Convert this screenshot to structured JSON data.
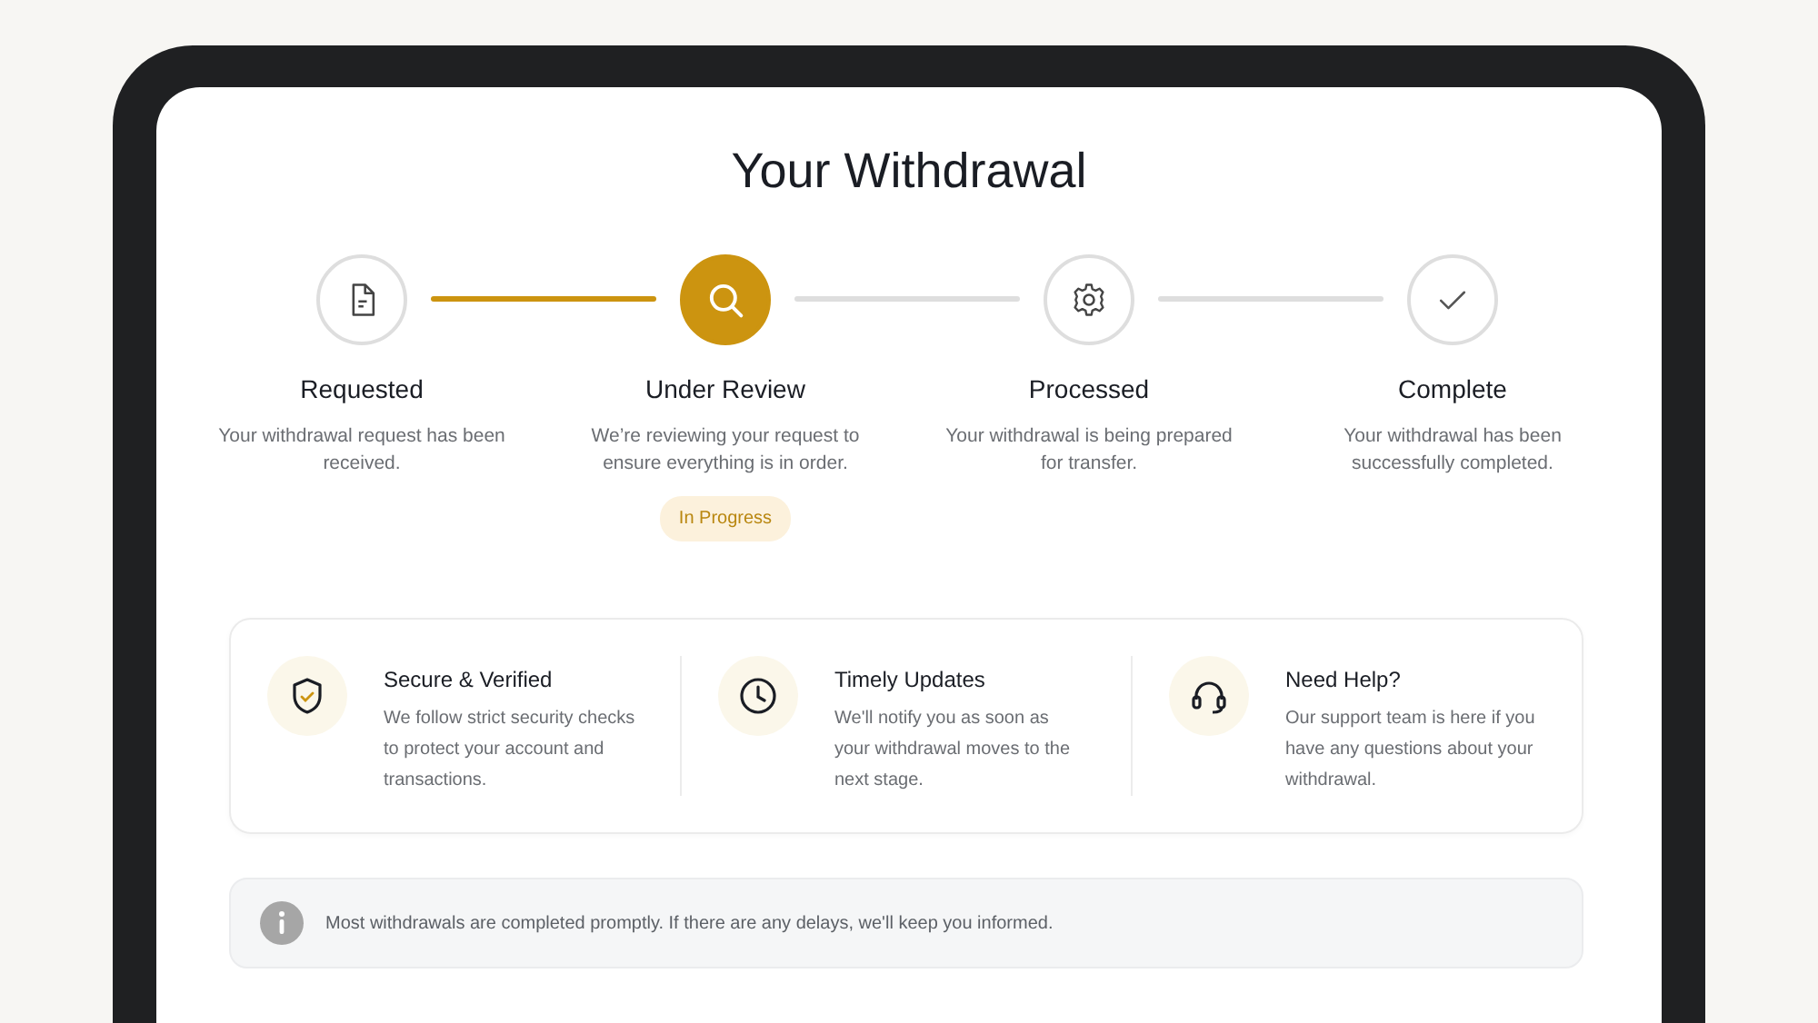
{
  "title": "Your Withdrawal",
  "steps": [
    {
      "label": "Requested",
      "description": "Your withdrawal request has been received.",
      "current": false
    },
    {
      "label": "Under Review",
      "description": "We’re reviewing your request to ensure everything is in order.",
      "current": true,
      "badge": "In Progress"
    },
    {
      "label": "Processed",
      "description": "Your withdrawal is being prepared for transfer.",
      "current": false
    },
    {
      "label": "Complete",
      "description": "Your withdrawal has been successfully completed.",
      "current": false
    }
  ],
  "connectors": [
    {
      "completed": true
    },
    {
      "completed": false
    },
    {
      "completed": false
    }
  ],
  "features": [
    {
      "title": "Secure & Verified",
      "text": "We follow strict security checks to protect your account and transactions."
    },
    {
      "title": "Timely Updates",
      "text": "We'll notify you as soon as your withdrawal moves to the next stage."
    },
    {
      "title": "Need Help?",
      "text": "Our support team is here if you have any questions about your withdrawal."
    }
  ],
  "notice": "Most withdrawals are completed promptly. If there are any delays, we'll keep you informed."
}
